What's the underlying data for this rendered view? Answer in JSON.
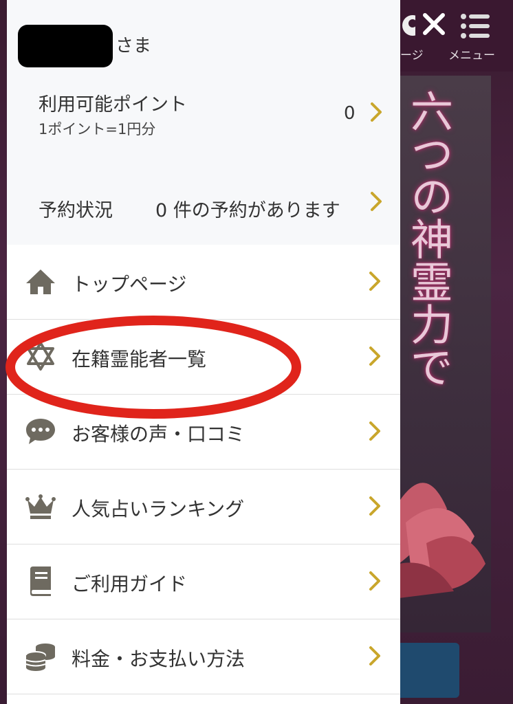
{
  "header": {
    "message_label": "ージ",
    "menu_label": "メニュー",
    "close_icon": "close-icon",
    "menu_icon": "list-menu-icon"
  },
  "hero": {
    "text": "六つの神霊力で"
  },
  "user": {
    "name_redacted": true,
    "suffix": "さま"
  },
  "points": {
    "label": "利用可能ポイント",
    "sub": "1ポイント=1円分",
    "value": "0"
  },
  "reservation": {
    "label": "予約状況",
    "status": "0 件の予約があります"
  },
  "menu": {
    "items": [
      {
        "label": "トップページ",
        "icon": "home-icon"
      },
      {
        "label": "在籍霊能者一覧",
        "icon": "star-of-david-icon"
      },
      {
        "label": "お客様の声・口コミ",
        "icon": "speech-bubble-icon"
      },
      {
        "label": "人気占いランキング",
        "icon": "crown-icon"
      },
      {
        "label": "ご利用ガイド",
        "icon": "book-icon"
      },
      {
        "label": "料金・お支払い方法",
        "icon": "coins-icon"
      }
    ]
  },
  "colors": {
    "chevron": "#c9a62c",
    "icon": "#6e6a60",
    "highlight_circle": "#e0241b",
    "background": "#4a2540"
  }
}
